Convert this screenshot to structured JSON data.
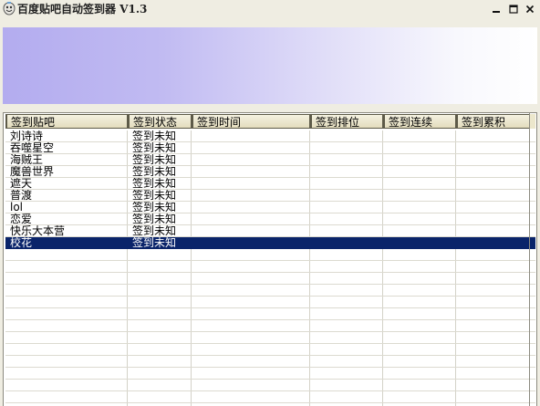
{
  "window": {
    "title": "百度贴吧自动签到器 V1.3",
    "icon": "app-icon",
    "controls": {
      "minimize": "minimize-icon",
      "maximize": "maximize-icon",
      "close": "close-icon"
    }
  },
  "banner": {
    "gradient_from": "#b3acef",
    "gradient_to": "#ffffff"
  },
  "table": {
    "columns": [
      "签到贴吧",
      "签到状态",
      "签到时间",
      "签到排位",
      "签到连续",
      "签到累积"
    ],
    "rows": [
      [
        "刘诗诗",
        "签到未知",
        "",
        "",
        "",
        ""
      ],
      [
        "吞噬星空",
        "签到未知",
        "",
        "",
        "",
        ""
      ],
      [
        "海贼王",
        "签到未知",
        "",
        "",
        "",
        ""
      ],
      [
        "魔兽世界",
        "签到未知",
        "",
        "",
        "",
        ""
      ],
      [
        "遮天",
        "签到未知",
        "",
        "",
        "",
        ""
      ],
      [
        "普渡",
        "签到未知",
        "",
        "",
        "",
        ""
      ],
      [
        "lol",
        "签到未知",
        "",
        "",
        "",
        ""
      ],
      [
        "恋爱",
        "签到未知",
        "",
        "",
        "",
        ""
      ],
      [
        "快乐大本营",
        "签到未知",
        "",
        "",
        "",
        ""
      ],
      [
        "校花",
        "签到未知",
        "",
        "",
        "",
        ""
      ]
    ],
    "selected_row": 9,
    "selection_color": "#0a246a"
  }
}
